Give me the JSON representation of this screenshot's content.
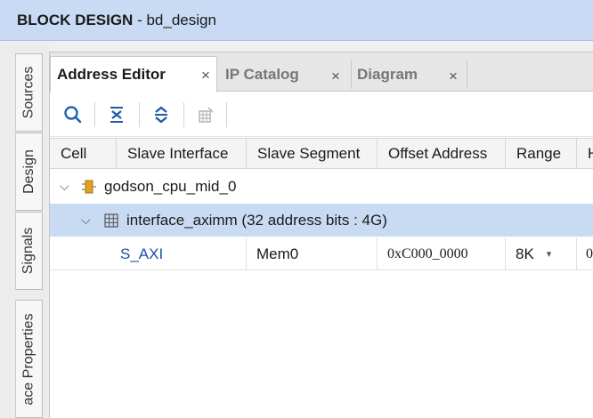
{
  "window": {
    "title_bold": "BLOCK DESIGN",
    "title_rest": " - bd_design"
  },
  "side_tabs": {
    "sources": "Sources",
    "design": "Design",
    "signals": "Signals",
    "properties": "ace Properties"
  },
  "tabs": [
    {
      "label": "Address Editor",
      "close": "×"
    },
    {
      "label": "IP Catalog",
      "close": "×"
    },
    {
      "label": "Diagram",
      "close": "×"
    }
  ],
  "table": {
    "columns": [
      "Cell",
      "Slave Interface",
      "Slave Segment",
      "Offset Address",
      "Range",
      "H"
    ],
    "rows": [
      {
        "label": "godson_cpu_mid_0"
      },
      {
        "label": "interface_aximm (32 address bits : 4G)"
      },
      {
        "slave_interface": "S_AXI",
        "slave_segment": "Mem0",
        "offset": "0xC000_0000",
        "range": "8K",
        "high": "0"
      }
    ]
  },
  "colors": {
    "titlebar": "#c8daf4",
    "selected_row": "#c9daf3",
    "link": "#1f4fa8",
    "ip_icon": "#e0a020"
  }
}
